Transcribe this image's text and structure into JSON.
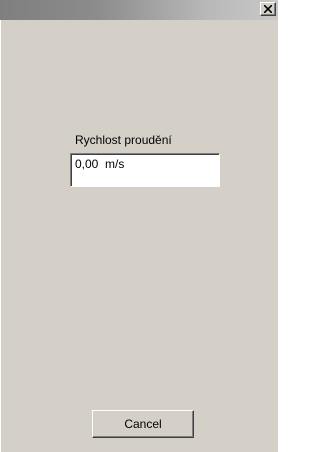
{
  "window": {
    "title": "",
    "close_label": "close"
  },
  "form": {
    "flow_speed_label": "Rychlost proudění",
    "flow_speed_value": "0,00  m/s"
  },
  "buttons": {
    "cancel_label": "Cancel"
  },
  "icons": {
    "close": "close-icon"
  },
  "colors": {
    "face": "#d4d0c8",
    "titlebar_start": "#7f7f7f",
    "titlebar_end": "#c8c8c8"
  }
}
